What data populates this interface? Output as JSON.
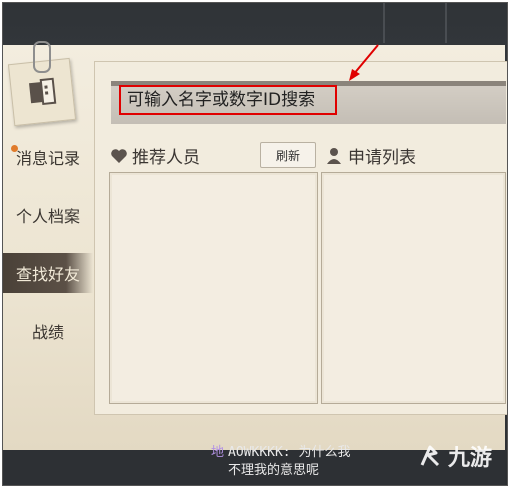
{
  "sidebar": {
    "items": [
      {
        "label": "消息记录",
        "active": false,
        "has_badge": true
      },
      {
        "label": "个人档案",
        "active": false,
        "has_badge": false
      },
      {
        "label": "查找好友",
        "active": true,
        "has_badge": false
      },
      {
        "label": "战绩",
        "active": false,
        "has_badge": false
      }
    ]
  },
  "search": {
    "placeholder": "可输入名字或数字ID搜索",
    "value": ""
  },
  "recommended": {
    "title": "推荐人员",
    "refresh_label": "刷新",
    "icon": "heart-icon"
  },
  "requests": {
    "title": "申请列表",
    "icon": "person-pin-icon"
  },
  "chat": {
    "channel": "地",
    "line1": "AOWKKKK: 为什么我",
    "line2": "不理我的意思呢"
  },
  "watermark": {
    "text": "九游"
  },
  "colors": {
    "annotation": "#e00000",
    "active_nav": "#4a4138",
    "badge": "#e07b2b",
    "chat_channel": "#b392e4"
  }
}
